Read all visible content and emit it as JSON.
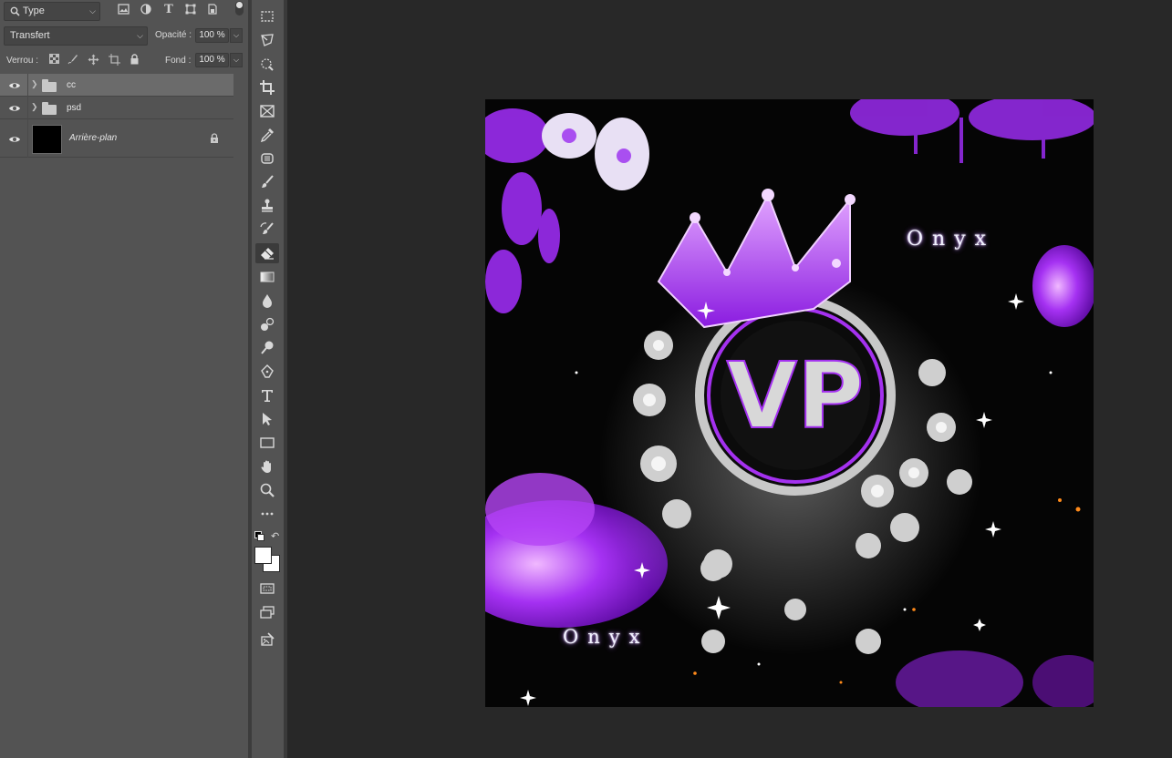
{
  "layers_panel": {
    "filter_type": "Type",
    "blend_mode": "Transfert",
    "opacity_label": "Opacité :",
    "opacity_value": "100 %",
    "lock_label": "Verrou :",
    "fill_label": "Fond :",
    "fill_value": "100 %",
    "layers": [
      {
        "name": "cc",
        "kind": "group",
        "selected": true
      },
      {
        "name": "psd",
        "kind": "group",
        "selected": false
      },
      {
        "name": "Arrière-plan",
        "kind": "background",
        "locked": true
      }
    ]
  },
  "toolbar": {
    "tools": [
      "marquee-icon",
      "lasso-icon",
      "quick-select-icon",
      "crop-icon",
      "frame-icon",
      "eyedropper-icon",
      "healing-icon",
      "brush-icon",
      "stamp-icon",
      "history-brush-icon",
      "eraser-icon",
      "gradient-icon",
      "blur-icon",
      "dodge-icon",
      "pen-icon",
      "type-icon",
      "path-select-icon",
      "rectangle-icon",
      "hand-icon",
      "zoom-icon",
      "more-icon"
    ],
    "active_tool": "eraser-icon",
    "foreground_color": "#ffffff",
    "background_color": "#ffffff"
  },
  "canvas": {
    "artwork_text_top": "Onyx",
    "artwork_text_bottom": "Onyx",
    "artwork_monogram": "VP",
    "accent_color": "#9b2cf0"
  }
}
